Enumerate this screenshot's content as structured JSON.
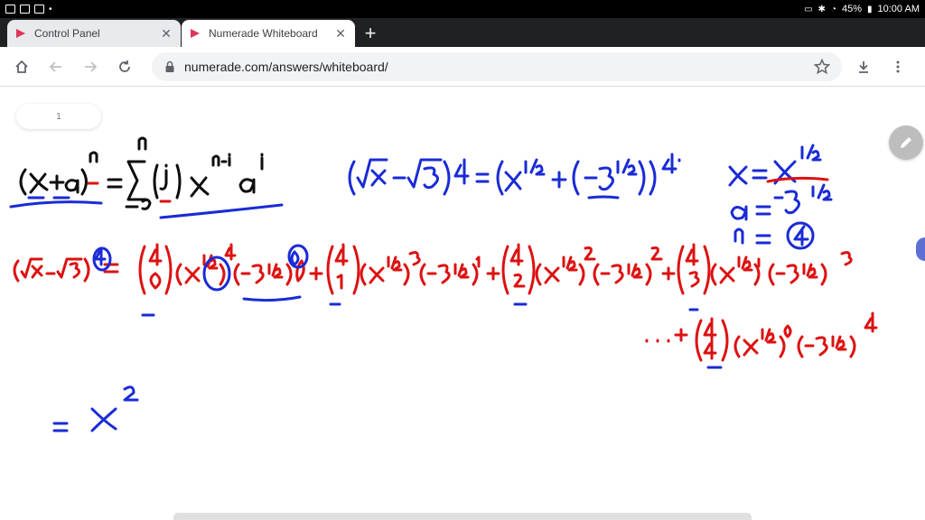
{
  "status_bar": {
    "battery": "45%",
    "time": "10:00 AM"
  },
  "tabs": [
    {
      "label": "Control Panel",
      "active": false
    },
    {
      "label": "Numerade Whiteboard",
      "active": true
    }
  ],
  "toolbar": {
    "url": "numerade.com/answers/whiteboard/"
  },
  "whiteboard": {
    "page_number": "1",
    "ink_colors": {
      "black": "#0d0d0d",
      "blue": "#1a2bd6",
      "red": "#dd1111"
    }
  }
}
